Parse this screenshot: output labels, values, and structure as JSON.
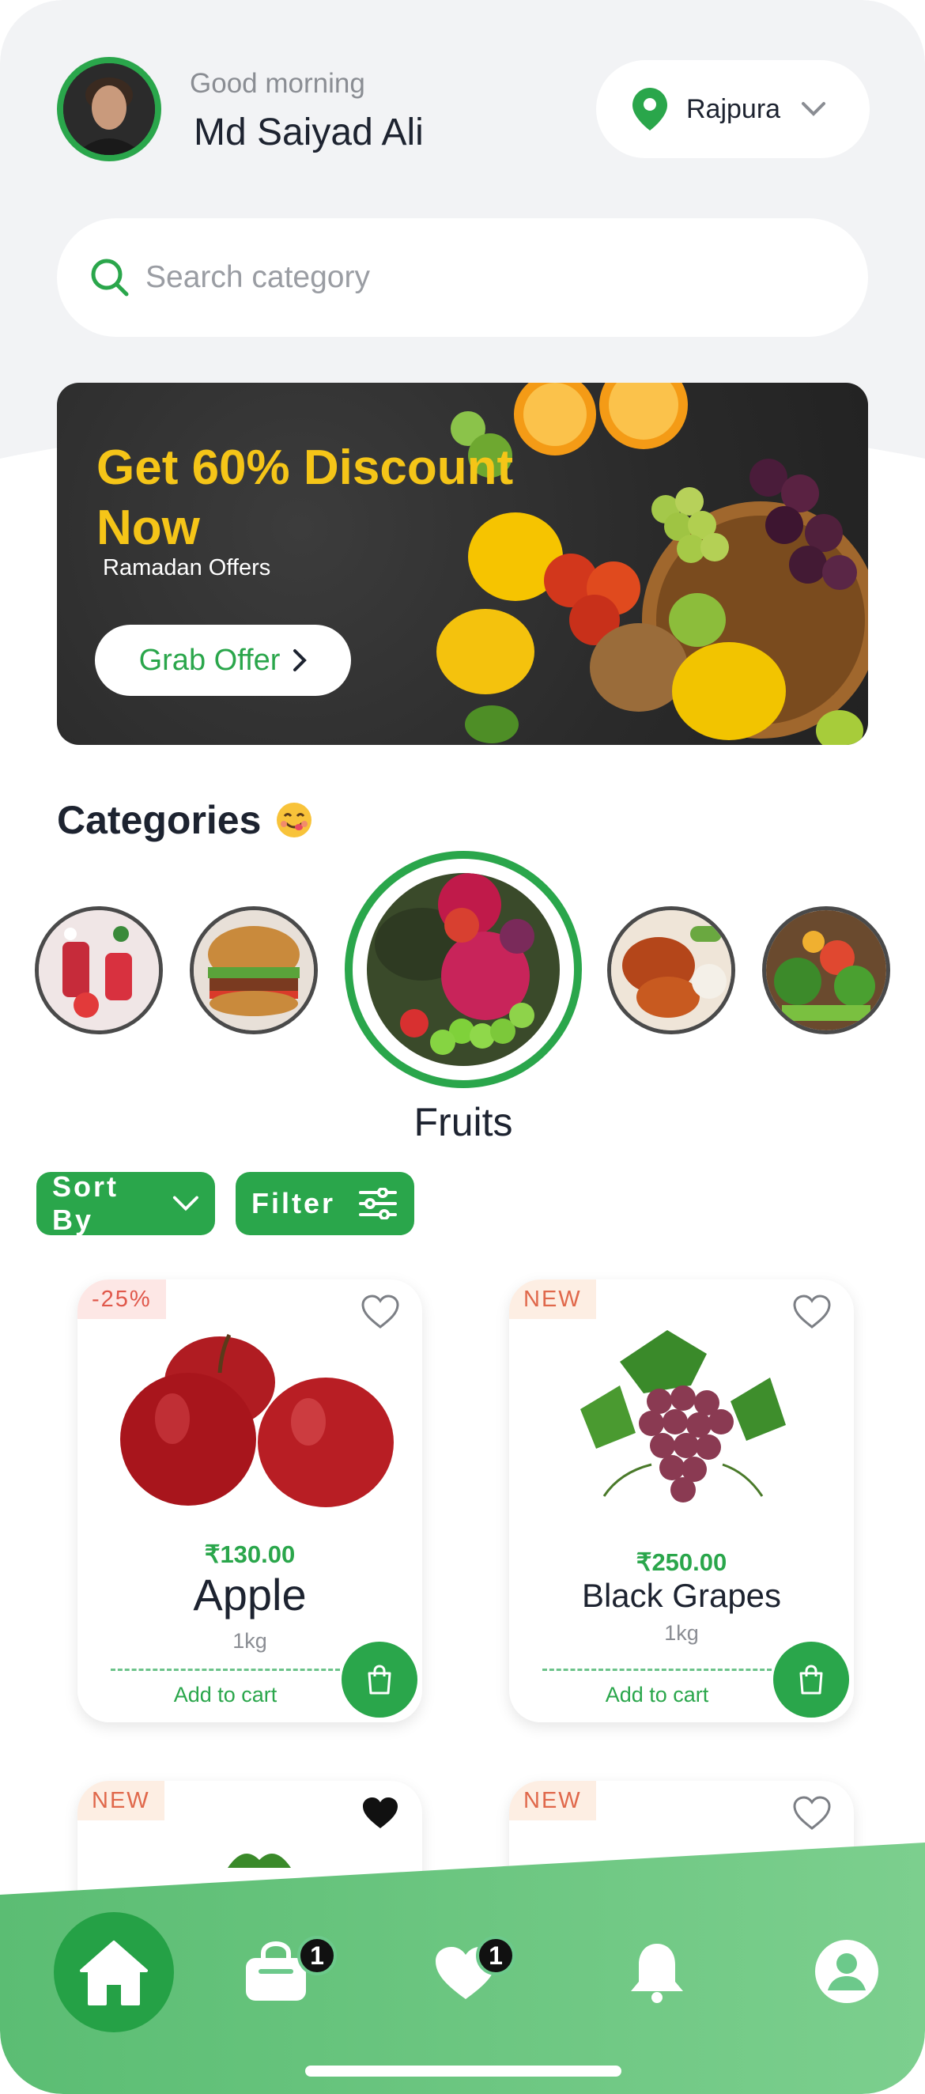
{
  "header": {
    "greeting": "Good morning",
    "username": "Md Saiyad Ali",
    "location": "Rajpura"
  },
  "search": {
    "placeholder": "Search category"
  },
  "banner": {
    "title": "Get 60% Discount Now",
    "subtitle": "Ramadan Offers",
    "button_label": "Grab Offer"
  },
  "categories": {
    "title": "Categories",
    "emoji": "😋",
    "selected_label": "Fruits"
  },
  "toolbar": {
    "sort_label": "Sort By",
    "filter_label": "Filter"
  },
  "products": [
    {
      "badge": "-25%",
      "price": "₹130.00",
      "name": "Apple",
      "qty": "1kg",
      "add_label": "Add to cart",
      "favorited": false
    },
    {
      "badge": "NEW",
      "price": "₹250.00",
      "name": "Black Grapes",
      "qty": "1kg",
      "add_label": "Add to cart",
      "favorited": false
    },
    {
      "badge": "NEW",
      "favorited": true
    },
    {
      "badge": "NEW",
      "favorited": false
    }
  ],
  "nav": {
    "cart_count": "1",
    "wishlist_count": "1",
    "icons": [
      "home-icon",
      "bag-icon",
      "heart-icon",
      "bell-icon",
      "profile-icon"
    ]
  },
  "colors": {
    "primary": "#2aa64b",
    "banner_title": "#f5c518",
    "badge_text": "#e0584b",
    "badge_bg": "#fde7e5"
  }
}
